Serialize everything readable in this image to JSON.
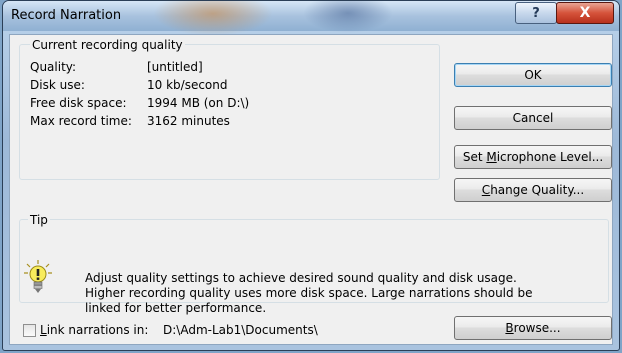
{
  "window": {
    "title": "Record Narration",
    "help_glyph": "?",
    "close_glyph": "X"
  },
  "quality_group": {
    "title": "Current recording quality",
    "rows": [
      {
        "label": "Quality:",
        "value": "[untitled]"
      },
      {
        "label": "Disk use:",
        "value": "10 kb/second"
      },
      {
        "label": "Free disk space:",
        "value": "1994 MB (on D:\\)"
      },
      {
        "label": "Max record time:",
        "value": "3162 minutes"
      }
    ]
  },
  "buttons": {
    "ok": "OK",
    "cancel": "Cancel",
    "mic_pre": "Set ",
    "mic_key": "M",
    "mic_post": "icrophone Level...",
    "quality_key": "C",
    "quality_post": "hange Quality...",
    "browse_key": "B",
    "browse_post": "rowse..."
  },
  "tip": {
    "title": "Tip",
    "text": "Adjust quality settings to achieve desired sound quality and disk usage. Higher recording quality uses more disk space. Large narrations should be linked for better performance.",
    "icon": "lightbulb-icon"
  },
  "link": {
    "checked": false,
    "key": "L",
    "label_post": "ink narrations in:",
    "path": "D:\\Adm-Lab1\\Documents\\"
  }
}
